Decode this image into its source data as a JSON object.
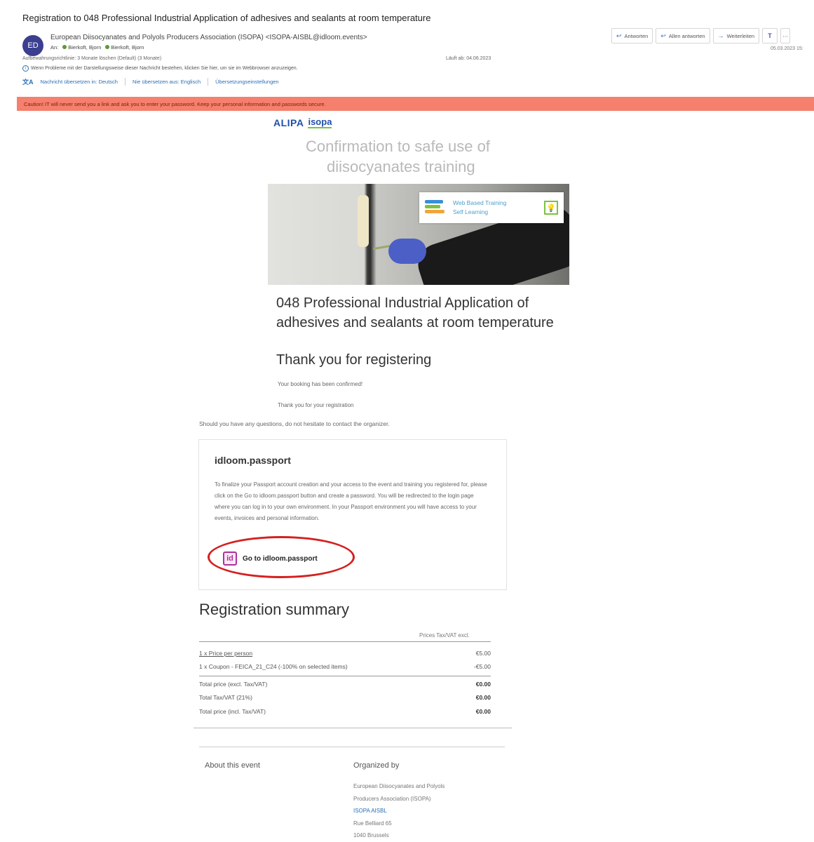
{
  "email": {
    "subject": "Registration to 048 Professional Industrial Application of adhesives and sealants at room temperature",
    "avatar_initials": "ED",
    "sender": "European Diisocyanates and Polyols Producers Association (ISOPA) <ISOPA-AISBL@idloom.events>",
    "to_label": "An:",
    "recipient_1": "Bierkoft, Bjorn",
    "recipient_2": "Bierkoft, Bjorn",
    "retention": "Aufbewahrungsrichtlinie: 3 Monate löschen (Default) (3 Monate)",
    "expires": "Läuft ab: 04.06.2023",
    "info_line": "Wenn Probleme mit der Darstellungsweise dieser Nachricht bestehen, klicken Sie hier, um sie im Webbrowser anzuzeigen.",
    "translate_link_1": "Nachricht übersetzen in: Deutsch",
    "translate_link_2": "Nie übersetzen aus: Englisch",
    "translate_link_3": "Übersetzungseinstellungen",
    "date": "05.03.2023 15:",
    "warning": "Caution! IT will never send you a link and ask you to enter your password. Keep your personal information and passwords secure."
  },
  "actions": {
    "reply": "Antworten",
    "reply_all": "Allen antworten",
    "forward": "Weiterleiten",
    "teams_glyph": "T",
    "more_glyph": "⋯"
  },
  "body": {
    "logo_alipa": "ALIPA",
    "logo_isopa": "isopa",
    "confirm_line_1": "Confirmation to safe use of",
    "confirm_line_2": "diisocyanates training",
    "hero_card_text": "Web Based Training\nSelf Learning",
    "course_title": "048 Professional Industrial Application of adhesives and sealants at room temperature",
    "thank_you": "Thank you for registering",
    "booking_confirmed": "Your booking has been confirmed!",
    "thank_reg": "Thank you for your registration",
    "questions": "Should you have any questions, do not hesitate to contact the organizer."
  },
  "passport": {
    "title": "idloom.passport",
    "text": "To finalize your Passport account creation and your access to the event and training you registered for, please click on the Go to idloom.passport button and create a password. You will be redirected to the login page where you can log in to your own environment. In your Passport environment you will have access to your events, invoices and personal information.",
    "button_icon": "id",
    "button_label": "Go to idloom.passport"
  },
  "summary": {
    "title": "Registration summary",
    "price_header": "Prices Tax/VAT excl.",
    "rows": [
      {
        "label": "1 x Price per person",
        "value": "€5.00"
      },
      {
        "label": "1 x Coupon - FEICA_21_C24 (-100% on selected items)",
        "value": "-€5.00"
      }
    ],
    "totals": [
      {
        "label": "Total price (excl. Tax/VAT)",
        "value": "€0.00"
      },
      {
        "label": "Total Tax/VAT (21%)",
        "value": "€0.00"
      },
      {
        "label": "Total price (incl. Tax/VAT)",
        "value": "€0.00"
      }
    ]
  },
  "footer": {
    "about": "About this event",
    "organized_by": "Organized by",
    "org_line_1": "European Diisocyanates and Polyols",
    "org_line_2": "Producers Association (ISOPA)",
    "org_line_3": "ISOPA AISBL",
    "org_line_4": "Rue Belliard 65",
    "org_line_5": "1040 Brussels"
  },
  "colors": {
    "warning_bg": "#f4806d",
    "brand_blue": "#1f4fa8",
    "highlight_circle": "#d42020",
    "passport_icon": "#b0309a"
  }
}
